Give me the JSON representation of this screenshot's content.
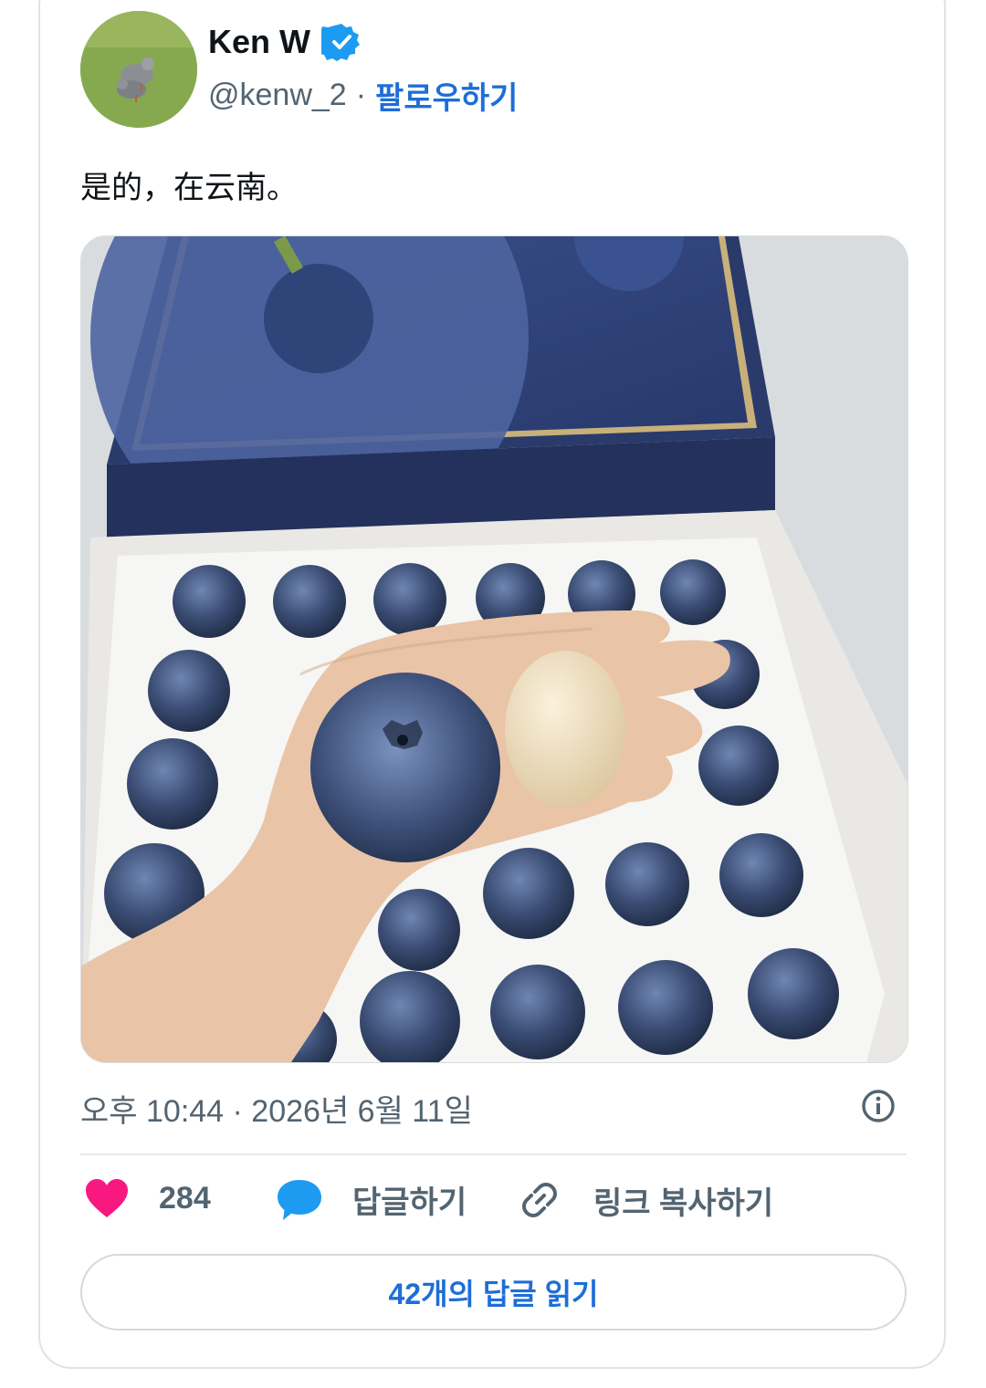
{
  "author": {
    "name": "Ken W",
    "handle": "@kenw_2",
    "separator": "·",
    "follow_label": "팔로우하기",
    "verified": true
  },
  "tweet": {
    "text": "是的，在云南。",
    "timestamp": "오후 10:44 · 2026년 6월 11일"
  },
  "actions": {
    "like_count": "284",
    "reply_label": "답글하기",
    "copy_link_label": "링크 복사하기"
  },
  "read_replies_label": "42개의 답글 읽기",
  "icons": {
    "verified": "verified-badge-icon",
    "info": "info-icon",
    "like": "heart-icon",
    "reply": "speech-bubble-icon",
    "copy": "link-icon"
  },
  "colors": {
    "link_blue": "#1d6ed8",
    "heart_pink": "#f91880",
    "reply_blue": "#1d9bf0",
    "muted_text": "#536471"
  }
}
